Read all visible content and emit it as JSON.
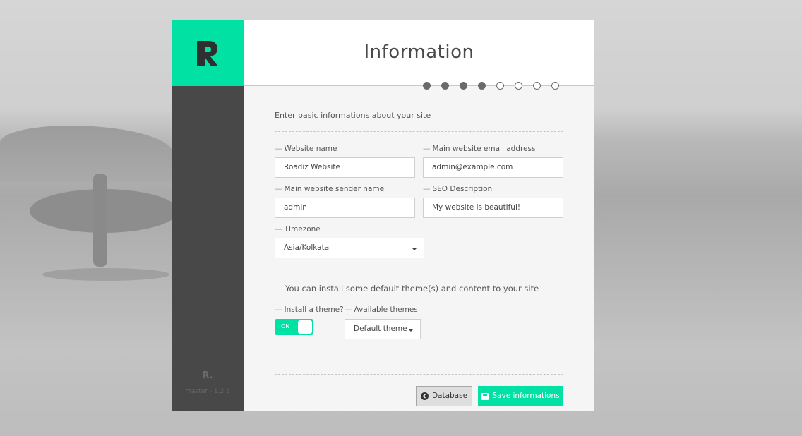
{
  "window": {
    "title": "Information"
  },
  "brand": {
    "logo_letter": "R",
    "mini_logo": "R.",
    "version": "master - 1.2.3",
    "accent_color": "#00e1a3"
  },
  "steps": {
    "total": 8,
    "completed": 4
  },
  "intro": "Enter basic informations about your site",
  "fields": {
    "website_name": {
      "label": "Website name",
      "value": "Roadiz Website"
    },
    "email": {
      "label": "Main website email address",
      "value": "admin@example.com"
    },
    "sender_name": {
      "label": "Main website sender name",
      "value": "admin"
    },
    "seo_description": {
      "label": "SEO Description",
      "value": "My website is beautiful!"
    },
    "timezone": {
      "label": "TImezone",
      "value": "Asia/Kolkata"
    }
  },
  "themes": {
    "intro": "You can install some default theme(s) and content to your site",
    "install_label": "Install a theme?",
    "toggle_text": "ON",
    "available_label": "Available themes",
    "selected": "Default theme"
  },
  "buttons": {
    "database": "Database",
    "save": "Save informations"
  },
  "icons": {
    "database_icon": "circle-arrow-left-icon",
    "save_icon": "floppy-disk-icon"
  }
}
